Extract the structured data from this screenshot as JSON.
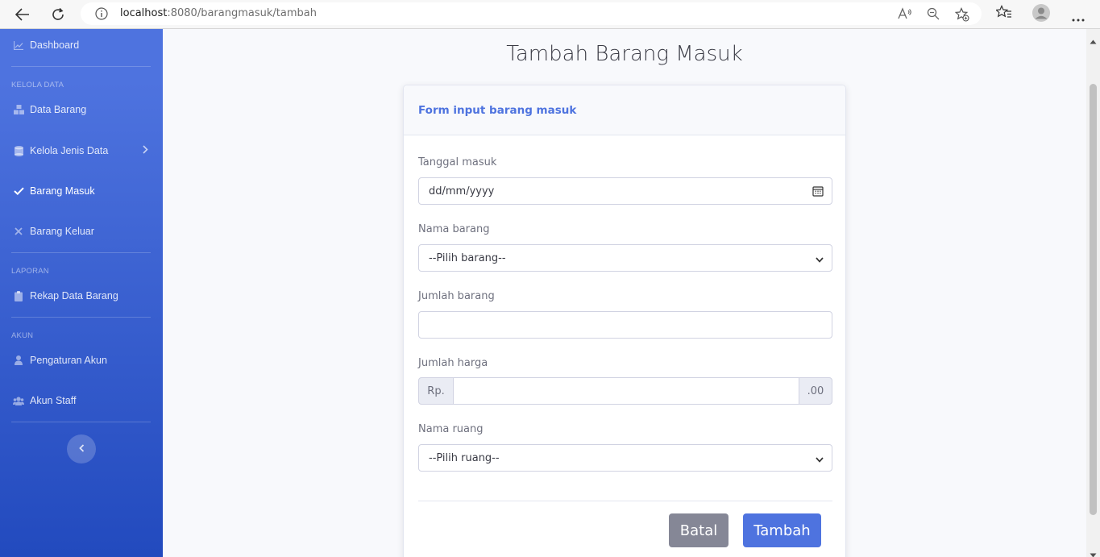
{
  "browser": {
    "url_host": "localhost",
    "url_rest": ":8080/barangmasuk/tambah",
    "icons": [
      "back-icon",
      "reload-icon",
      "info-icon",
      "read-aloud-icon",
      "zoom-out-icon",
      "add-favorite-icon",
      "favorites-icon",
      "profile-icon",
      "more-icon"
    ]
  },
  "sidebar": {
    "dashboard": "Dashboard",
    "heading_kelola": "KELOLA DATA",
    "data_barang": "Data Barang",
    "kelola_jenis": "Kelola Jenis Data",
    "barang_masuk": "Barang Masuk",
    "barang_keluar": "Barang Keluar",
    "heading_laporan": "LAPORAN",
    "rekap": "Rekap Data Barang",
    "heading_akun": "AKUN",
    "pengaturan": "Pengaturan Akun",
    "akun_staff": "Akun Staff"
  },
  "page": {
    "title": "Tambah Barang Masuk"
  },
  "form": {
    "header": "Form input barang masuk",
    "tanggal_label": "Tanggal masuk",
    "tanggal_placeholder": "dd/mm/yyyy",
    "nama_barang_label": "Nama barang",
    "nama_barang_selected": "--Pilih barang--",
    "jumlah_barang_label": "Jumlah barang",
    "jumlah_barang_value": "",
    "jumlah_harga_label": "Jumlah harga",
    "harga_prefix": "Rp.",
    "harga_suffix": ".00",
    "nama_ruang_label": "Nama ruang",
    "nama_ruang_selected": "--Pilih ruang--",
    "batal": "Batal",
    "tambah": "Tambah"
  },
  "colors": {
    "primary": "#4e73df",
    "secondary": "#858796",
    "sidebar_top": "#4e73df",
    "sidebar_bottom": "#224abe"
  }
}
